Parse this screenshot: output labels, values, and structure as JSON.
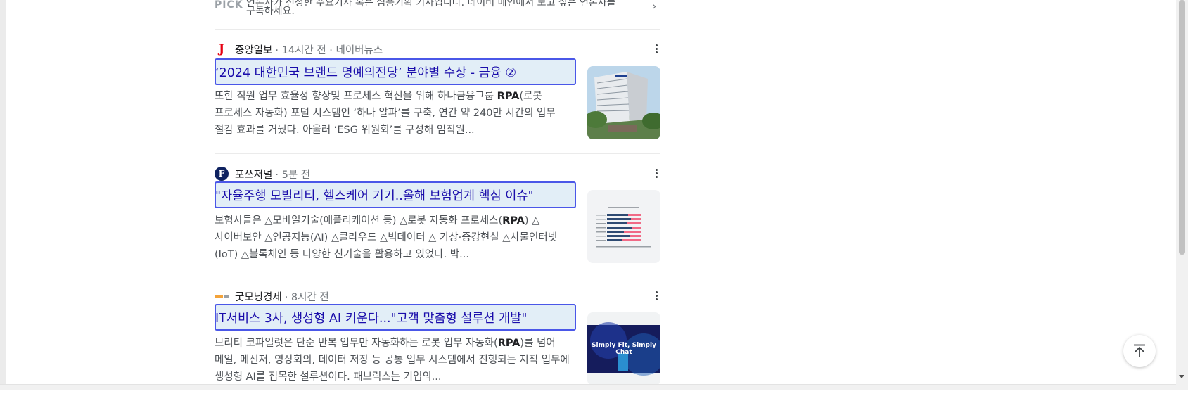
{
  "pick_card": {
    "label": "PICK",
    "cut_text": "언론사가 선정한 주요기사 혹은 심층기획 기사입니다. 네이버 메인에서 보고 싶은 언론사를",
    "text": "구독하세요."
  },
  "articles": [
    {
      "logo_letter": "J",
      "source": "중앙일보",
      "meta": "· 14시간 전 · 네이버뉴스",
      "title": "‘2024 대한민국 브랜드 명예의전당’ 분야별 수상 - 금융 ②",
      "snippet_1": "또한 직원 업무 효율성 향상및 프로세스 혁신을 위해 하나금융그룹 ",
      "snippet_bold": "RPA",
      "snippet_2": "(로봇 프로세스 자동화) 포털 시스템인 ‘하나 알파’를 구축, 연간 약 240만 시간의 업무 절감 효과를 거뒀다. 아울러 ‘ESG 위원회’를 구성해 임직원..."
    },
    {
      "logo_letter": "F",
      "source": "포쓰저널",
      "meta": "· 5분 전",
      "title": "\"자율주행 모빌리티, 헬스케어 기기..올해 보험업계 핵심 이슈\"",
      "snippet_1": "보험사들은 △모바일기술(애플리케이션 등) △로봇 자동화 프로세스(",
      "snippet_bold": "RPA",
      "snippet_2": ") △사이버보안 △인공지능(AI) △클라우드 △빅데이터 △ 가상·증강현실 △사물인터넷(IoT) △블록체인 등 다양한 신기술을 활용하고 있었다. 박..."
    },
    {
      "logo_letter": "",
      "source": "굿모닝경제",
      "meta": "· 8시간 전",
      "title": "IT서비스 3사, 생성형 AI 키운다...\"고객 맞춤형 설루션 개발\"",
      "snippet_1": "브리티 코파일럿은 단순 반복 업무만 자동화하는 로봇 업무 자동화(",
      "snippet_bold": "RPA",
      "snippet_2": ")를 넘어 메일, 메신저, 영상회의, 데이터 저장 등 공통 업무 시스템에서 진행되는 지적 업무에 생성형 AI를 접목한 설루션이다. 패브릭스는 기업의...",
      "thumb_text": "Simply Fit, Simply Chat"
    }
  ],
  "colors": {
    "link": "#1a0dab",
    "highlight_border": "#4a57e8",
    "highlight_fill": "#e2eef7",
    "joongang_red": "#e60012",
    "forbes_navy": "#0f2260"
  }
}
